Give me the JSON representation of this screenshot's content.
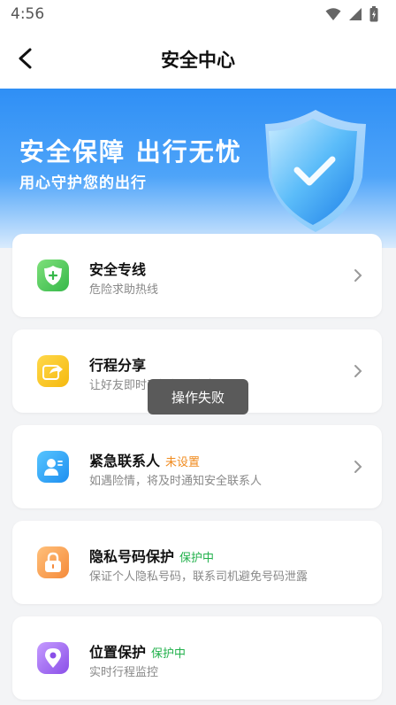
{
  "status_bar": {
    "time": "4:56"
  },
  "header": {
    "title": "安全中心"
  },
  "banner": {
    "headline": "安全保障 出行无忧",
    "subline": "用心守护您的出行"
  },
  "cards": [
    {
      "title": "安全专线",
      "subtitle": "危险求助热线",
      "tag": "",
      "icon": "shield-plus-icon",
      "has_chevron": true
    },
    {
      "title": "行程分享",
      "subtitle": "让好友即时了解行程信息",
      "tag": "",
      "icon": "share-icon",
      "has_chevron": true
    },
    {
      "title": "紧急联系人",
      "subtitle": "如遇险情，将及时通知安全联系人",
      "tag": "未设置",
      "icon": "contact-icon",
      "has_chevron": true
    },
    {
      "title": "隐私号码保护",
      "subtitle": "保证个人隐私号码，联系司机避免号码泄露",
      "tag": "保护中",
      "icon": "lock-icon",
      "has_chevron": false
    },
    {
      "title": "位置保护",
      "subtitle": "实时行程监控",
      "tag": "保护中",
      "icon": "location-pin-icon",
      "has_chevron": false
    }
  ],
  "toast": {
    "text": "操作失败"
  },
  "colors": {
    "tag_unset": "#f08a1c",
    "tag_protected": "#22b14c",
    "banner_blue": "#2f8ff5"
  }
}
